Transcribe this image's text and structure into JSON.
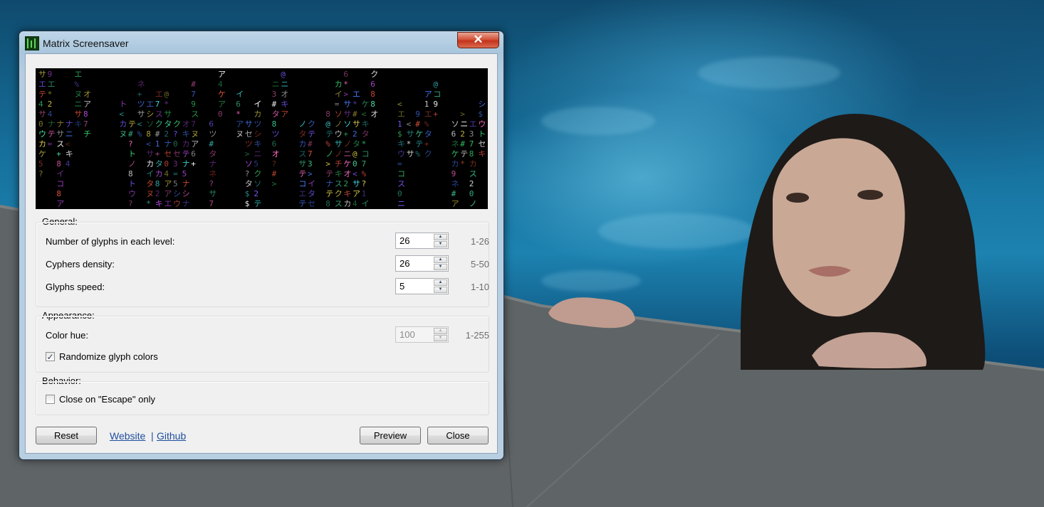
{
  "window": {
    "title": "Matrix Screensaver",
    "close_glyph": "✕"
  },
  "preview": {
    "palette": [
      "#3bd16f",
      "#4a7dff",
      "#e0533b",
      "#b34be0",
      "#e0d34a",
      "#3fd9d9",
      "#ff6ec7",
      "#ffffff",
      "#7c5cff",
      "#46e0a0"
    ]
  },
  "general": {
    "label": "General:",
    "glyphs": {
      "label": "Number of glyphs in each level:",
      "value": "26",
      "range": "1-26"
    },
    "density": {
      "label": "Cyphers density:",
      "value": "26",
      "range": "5-50"
    },
    "speed": {
      "label": "Glyphs speed:",
      "value": "5",
      "range": "1-10"
    }
  },
  "appearance": {
    "label": "Appearance:",
    "hue": {
      "label": "Color hue:",
      "value": "100",
      "range": "1-255",
      "disabled": true
    },
    "randomize": {
      "label": "Randomize glyph colors",
      "checked": true,
      "mark": "✓"
    }
  },
  "behavior": {
    "label": "Behavior:",
    "escape_only": {
      "label": "Close on \"Escape\" only",
      "checked": false
    }
  },
  "footer": {
    "reset": "Reset",
    "website": "Website",
    "separator": "|",
    "github": "Github",
    "preview": "Preview",
    "close": "Close"
  },
  "icons": {
    "spin_up": "▲",
    "spin_down": "▼"
  }
}
